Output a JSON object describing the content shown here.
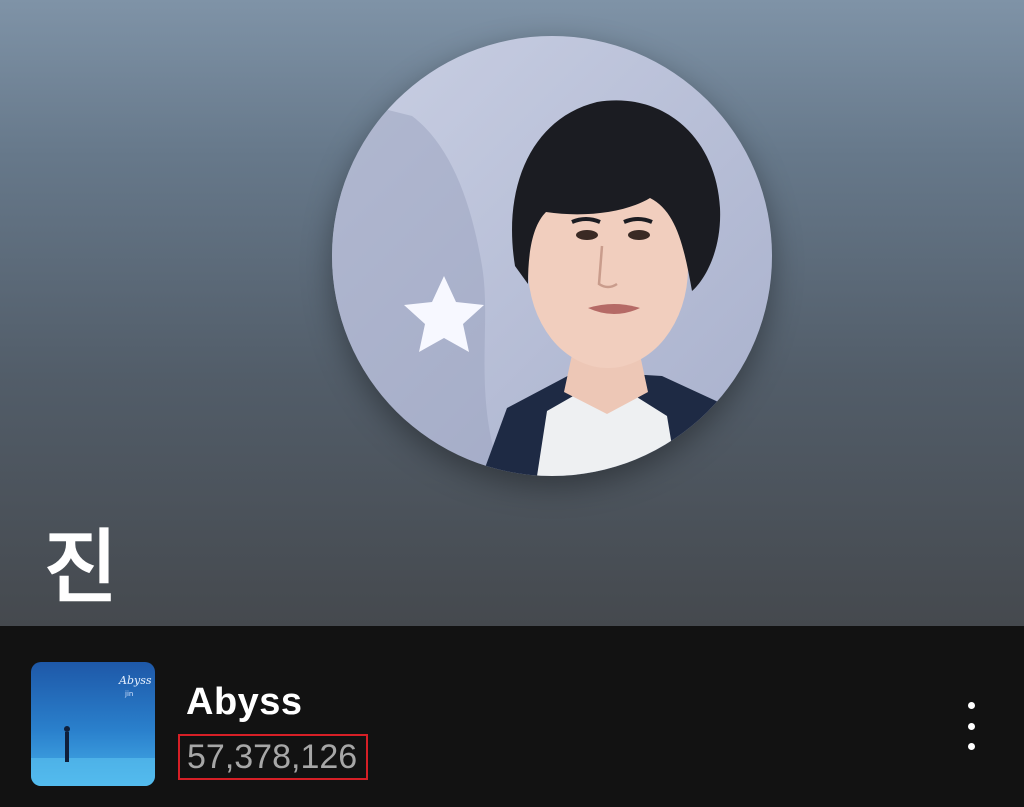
{
  "artist": {
    "name": "진",
    "avatar_icon": "artist-photo"
  },
  "track": {
    "title": "Abyss",
    "plays": "57,378,126",
    "cover_title": "Abyss",
    "cover_artist": "jin"
  },
  "menu": {
    "icon": "more-vertical-icon"
  },
  "colors": {
    "header_top": "#7f93a7",
    "header_bottom": "#45494e",
    "background": "#121212",
    "highlight": "#d61f26",
    "secondary_text": "#a7a7a7"
  }
}
